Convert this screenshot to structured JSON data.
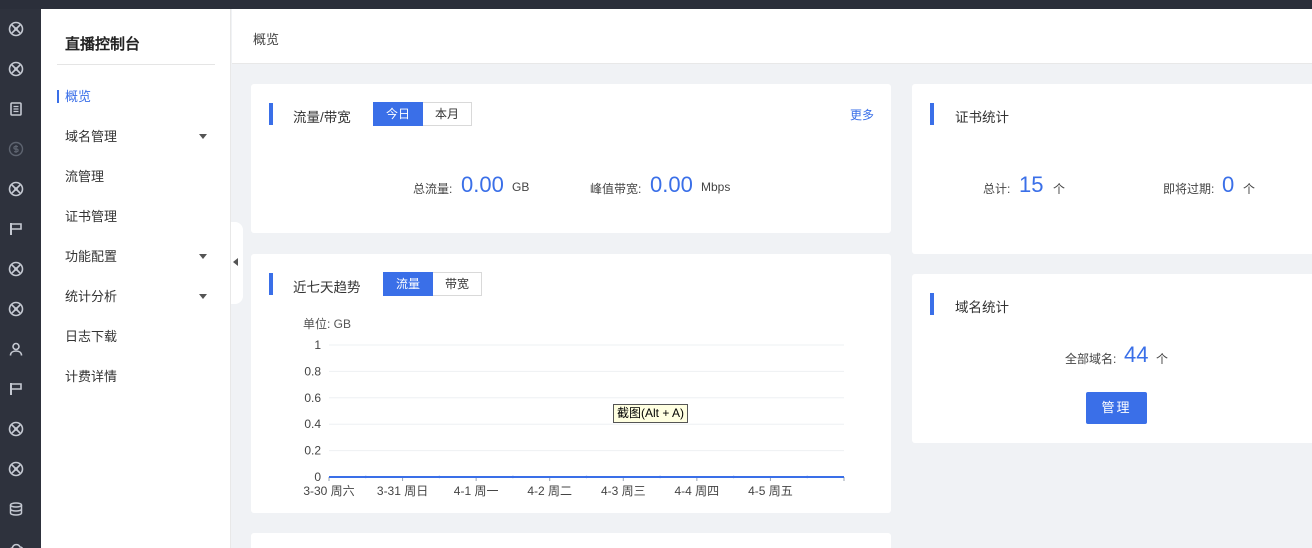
{
  "sidebar": {
    "title": "直播控制台",
    "items": [
      {
        "label": "概览",
        "active": true
      },
      {
        "label": "域名管理",
        "expandable": true
      },
      {
        "label": "流管理"
      },
      {
        "label": "证书管理"
      },
      {
        "label": "功能配置",
        "expandable": true
      },
      {
        "label": "统计分析",
        "expandable": true
      },
      {
        "label": "日志下载"
      },
      {
        "label": "计费详情"
      }
    ]
  },
  "rail_icons": [
    "network-icon",
    "network-icon",
    "document-icon",
    "dollar-icon",
    "network-icon",
    "flag-icon",
    "network-icon",
    "network-icon",
    "user-icon",
    "flag-icon",
    "network-icon",
    "network-icon",
    "database-icon",
    "cloud-icon"
  ],
  "header": {
    "breadcrumb": "概览"
  },
  "traffic": {
    "title": "流量/带宽",
    "tabs": [
      "今日",
      "本月"
    ],
    "active_tab": "今日",
    "more": "更多",
    "total_label": "总流量:",
    "total_value": "0.00",
    "total_unit": "GB",
    "peak_label": "峰值带宽:",
    "peak_value": "0.00",
    "peak_unit": "Mbps"
  },
  "trend": {
    "title": "近七天趋势",
    "tabs": [
      "流量",
      "带宽"
    ],
    "active_tab": "流量"
  },
  "cert": {
    "title": "证书统计",
    "total_label": "总计:",
    "total_value": "15",
    "total_unit": "个",
    "expiring_label": "即将过期:",
    "expiring_value": "0",
    "expiring_unit": "个"
  },
  "domain": {
    "title": "域名统计",
    "all_label": "全部域名:",
    "all_value": "44",
    "all_unit": "个",
    "manage_button": "管理"
  },
  "tooltip": "截图(Alt + A)",
  "colors": {
    "accent": "#3a6fe8",
    "rail": "#2e323d"
  },
  "chart_data": {
    "type": "line",
    "unit_label": "单位: GB",
    "categories": [
      "3-30 周六",
      "3-31 周日",
      "4-1 周一",
      "4-2 周二",
      "4-3 周三",
      "4-4 周四",
      "4-5 周五"
    ],
    "series": [
      {
        "values": [
          0,
          0,
          0,
          0,
          0,
          0,
          0
        ],
        "color": "#3a6fe8"
      }
    ],
    "yticks": [
      "0",
      "0.2",
      "0.4",
      "0.6",
      "0.8",
      "1"
    ],
    "ylim": [
      0,
      1
    ],
    "grid": true
  }
}
